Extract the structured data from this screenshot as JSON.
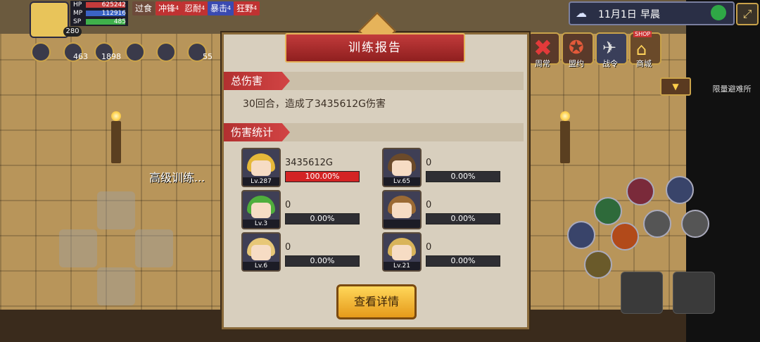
{
  "hud": {
    "level": "280",
    "hp_label": "HP",
    "hp_value": "625242",
    "mp_label": "MP",
    "mp_value": "112916",
    "sp_label": "SP",
    "sp_value": "485",
    "buffs": [
      {
        "label": "过食",
        "sup": ""
      },
      {
        "label": "冲锋",
        "sup": "4"
      },
      {
        "label": "忍耐",
        "sup": "4"
      },
      {
        "label": "暴击",
        "sup": "4"
      },
      {
        "label": "狂野",
        "sup": "4"
      }
    ],
    "status_counts": [
      "463",
      "1898",
      "55"
    ]
  },
  "datebar": {
    "date": "11月1日",
    "period": "早晨"
  },
  "top_menu": [
    {
      "label": "周常",
      "icon": "close-icon"
    },
    {
      "label": "盟约",
      "icon": "pentagram-icon"
    },
    {
      "label": "战令",
      "icon": "eagle-icon"
    },
    {
      "label": "商城",
      "icon": "shop-icon",
      "badge": "SHOP"
    }
  ],
  "shelter_label": "限量避难所",
  "scene_label": "高级训练...",
  "modal": {
    "title": "训练报告",
    "total_header": "总伤害",
    "summary": "30回合，造成了3435612G伤害",
    "stats_header": "伤害统计",
    "members": [
      {
        "damage": "3435612G",
        "percent": "100.00%",
        "share": 1.0,
        "level": "Lv.287",
        "hair": "#e5b83a"
      },
      {
        "damage": "0",
        "percent": "0.00%",
        "share": 0,
        "level": "Lv.65",
        "hair": "#6b4a2a"
      },
      {
        "damage": "0",
        "percent": "0.00%",
        "share": 0,
        "level": "Lv.3",
        "hair": "#4fae3c"
      },
      {
        "damage": "0",
        "percent": "0.00%",
        "share": 0,
        "level": "",
        "hair": "#9b6a34"
      },
      {
        "damage": "0",
        "percent": "0.00%",
        "share": 0,
        "level": "Lv.6",
        "hair": "#e7c777"
      },
      {
        "damage": "0",
        "percent": "0.00%",
        "share": 0,
        "level": "Lv.21",
        "hair": "#d9b45a"
      }
    ],
    "detail_button": "查看详情"
  },
  "colors": {
    "accent_red": "#c23b3b",
    "gold": "#e6b35a",
    "panel": "#d8cfbe"
  }
}
